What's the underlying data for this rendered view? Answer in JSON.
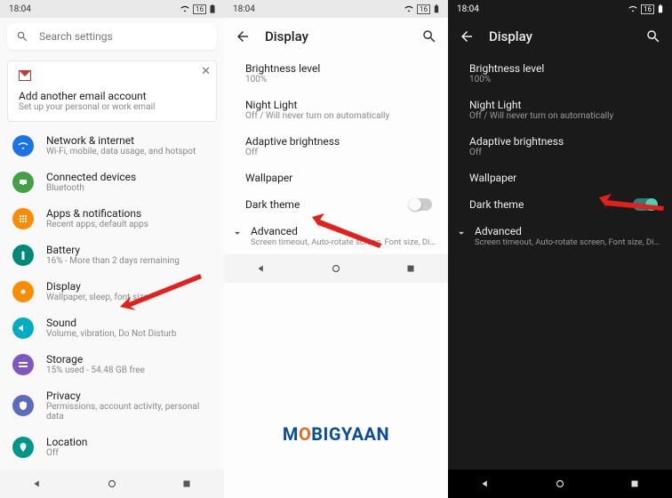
{
  "status": {
    "time": "18:04",
    "badge": "16"
  },
  "search": {
    "placeholder": "Search settings"
  },
  "email_card": {
    "title": "Add another email account",
    "subtitle": "Set up your personal or work email"
  },
  "settings_items": [
    {
      "title": "Network & internet",
      "subtitle": "Wi-Fi, mobile, data usage, and hotspot",
      "color": "#1a73e8",
      "icon": "wifi"
    },
    {
      "title": "Connected devices",
      "subtitle": "Bluetooth",
      "color": "#43a047",
      "icon": "devices"
    },
    {
      "title": "Apps & notifications",
      "subtitle": "Recent apps, default apps",
      "color": "#fb8c00",
      "icon": "apps"
    },
    {
      "title": "Battery",
      "subtitle": "16% - More than 2 days remaining",
      "color": "#00897b",
      "icon": "battery"
    },
    {
      "title": "Display",
      "subtitle": "Wallpaper, sleep, font size",
      "color": "#fb8c00",
      "icon": "display"
    },
    {
      "title": "Sound",
      "subtitle": "Volume, vibration, Do Not Disturb",
      "color": "#00acc1",
      "icon": "sound"
    },
    {
      "title": "Storage",
      "subtitle": "15% used - 54.48 GB free",
      "color": "#7e57c2",
      "icon": "storage"
    },
    {
      "title": "Privacy",
      "subtitle": "Permissions, account activity, personal data",
      "color": "#5c6bc0",
      "icon": "privacy"
    },
    {
      "title": "Location",
      "subtitle": "Off",
      "color": "#009688",
      "icon": "location"
    }
  ],
  "display": {
    "title": "Display",
    "brightness_label": "Brightness level",
    "brightness_value": "100%",
    "nightlight_label": "Night Light",
    "nightlight_value": "Off / Will never turn on automatically",
    "adaptive_label": "Adaptive brightness",
    "adaptive_value": "Off",
    "wallpaper_label": "Wallpaper",
    "darktheme_label": "Dark theme",
    "advanced_label": "Advanced",
    "advanced_value": "Screen timeout, Auto-rotate screen, Font size, Disp..."
  },
  "watermark": {
    "left": "M",
    "o": "O",
    "right": "BIGYAAN"
  }
}
